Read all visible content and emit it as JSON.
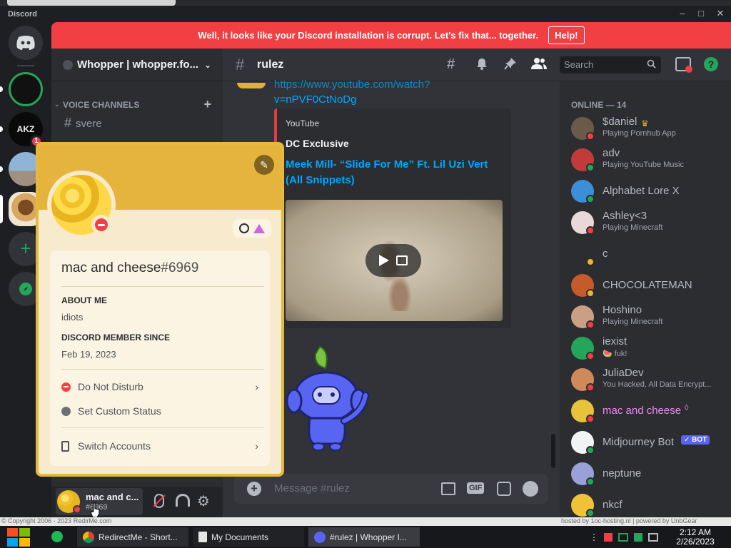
{
  "window": {
    "title": "Discord"
  },
  "banner": {
    "text": "Well, it looks like your Discord installation is corrupt. Let's fix that... together.",
    "button": "Help!"
  },
  "server": {
    "name": "Whopper | whopper.fo..."
  },
  "sidebar": {
    "category": "VOICE CHANNELS",
    "channel": "svere",
    "badge": "1"
  },
  "channel": {
    "name": "rulez",
    "search_placeholder": "Search"
  },
  "message": {
    "link": "https://www.youtube.com/watch?v=nPVF0CtNoDg",
    "link_line1": "https://www.youtube.com/watch?",
    "link_line2": "v=nPVF0CtNoDg",
    "embed_provider": "YouTube",
    "embed_author": "DC Exclusive",
    "embed_title": "Meek Mill- “Slide For Me” Ft. Lil Uzi Vert (All Snippets)"
  },
  "composer": {
    "placeholder": "Message #rulez",
    "gif": "GIF"
  },
  "profile": {
    "name": "mac and cheese",
    "discrim": "#6969",
    "about_header": "ABOUT ME",
    "about": "idiots",
    "since_header": "DISCORD MEMBER SINCE",
    "since": "Feb 19, 2023",
    "status": "Do Not Disturb",
    "custom_status": "Set Custom Status",
    "switch": "Switch Accounts"
  },
  "user_panel": {
    "name": "mac and c...",
    "tag": "#6969"
  },
  "members": {
    "header": "ONLINE — 14",
    "list": [
      {
        "name": "$daniel",
        "activity": "Playing Pornhub App",
        "color": "#b5bac1",
        "status": "#f23f43",
        "avatar": "#6b5a4a"
      },
      {
        "name": "adv",
        "activity": "Playing YouTube Music",
        "color": "#b5bac1",
        "status": "#23a55a",
        "avatar": "#c23b3b"
      },
      {
        "name": "Alphabet Lore X",
        "activity": "",
        "color": "#b5bac1",
        "status": "#23a55a",
        "avatar": "#3a8fd6"
      },
      {
        "name": "Ashley<3",
        "activity": "Playing Minecraft",
        "color": "#b5bac1",
        "status": "#f23f43",
        "avatar": "#e8d8d8"
      },
      {
        "name": "c",
        "activity": "",
        "color": "#b5bac1",
        "status": "#f0b232",
        "avatar": "#2b2d31"
      },
      {
        "name": "CHOCOLATEMAN",
        "activity": "",
        "color": "#b5bac1",
        "status": "#f0b232",
        "avatar": "#c55a2a"
      },
      {
        "name": "Hoshino",
        "activity": "Playing Minecraft",
        "color": "#b5bac1",
        "status": "#f23f43",
        "avatar": "#caa084"
      },
      {
        "name": "iexist",
        "activity": "🍉 fuk!",
        "color": "#b5bac1",
        "status": "#f23f43",
        "avatar": "#23a55a"
      },
      {
        "name": "JuliaDev",
        "activity": "You Hacked, All Data Encrypt...",
        "color": "#b5bac1",
        "status": "#f23f43",
        "avatar": "#d08a5a"
      },
      {
        "name": "mac and cheese",
        "activity": "",
        "color": "#ec89ee",
        "status": "#f23f43",
        "avatar": "#e8c23a"
      },
      {
        "name": "Midjourney Bot",
        "activity": "",
        "color": "#b5bac1",
        "status": "#23a55a",
        "avatar": "#f2f3f5"
      },
      {
        "name": "neptune",
        "activity": "",
        "color": "#b5bac1",
        "status": "#23a55a",
        "avatar": "#9aa0d8"
      },
      {
        "name": "nkcf",
        "activity": "",
        "color": "#b5bac1",
        "status": "#23a55a",
        "avatar": "#f0c23a"
      }
    ],
    "bot_badge": "✓ BOT"
  },
  "taskbar": {
    "items": [
      "RedirectMe - Short...",
      "My Documents",
      "#rulez | Whopper I..."
    ],
    "time": "2:12 AM",
    "date": "2/26/2023",
    "copyright": "© Copyright 2006 - 2023 RedirMe.com",
    "hosting": "hosted by 1oc-hosting.nl | powered by UnbGear"
  }
}
